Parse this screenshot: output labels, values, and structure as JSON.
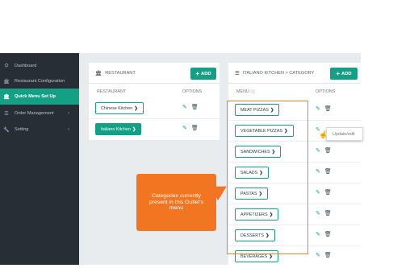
{
  "sidebar": {
    "items": [
      {
        "label": "Dashboard",
        "icon": "dashboard-icon",
        "glyph": "⛭",
        "active": false,
        "has_chevron": false
      },
      {
        "label": "Restaurant Configuration",
        "icon": "bank-icon",
        "glyph": "🏛",
        "active": false,
        "has_chevron": false
      },
      {
        "label": "Quick Menu Set Up",
        "icon": "bank-icon",
        "glyph": "🏛",
        "active": true,
        "has_chevron": false
      },
      {
        "label": "Order Management",
        "icon": "list-icon",
        "glyph": "☰",
        "active": false,
        "has_chevron": true
      },
      {
        "label": "Setting",
        "icon": "wrench-icon",
        "glyph": "🔧",
        "active": false,
        "has_chevron": true
      }
    ]
  },
  "restaurant_panel": {
    "title": "RESTAURANT",
    "add_label": "ADD",
    "col_restaurant": "RESTAURANT",
    "col_options": "OPTIONS",
    "rows": [
      {
        "name": "Chinese Kitchen",
        "selected": false
      },
      {
        "name": "Italiano Kitchen",
        "selected": true
      }
    ]
  },
  "category_panel": {
    "title": "ITALIANO KITCHEN > CATEGORY",
    "add_label": "ADD",
    "col_menu": "MENU",
    "col_options": "OPTIONS",
    "rows": [
      {
        "name": "MEAT PIZZAS"
      },
      {
        "name": "VEGETABLE PIZZAS"
      },
      {
        "name": "SANDWICHES"
      },
      {
        "name": "SALADS"
      },
      {
        "name": "PASTAS"
      },
      {
        "name": "APPETIZERS"
      },
      {
        "name": "DESSERTS"
      },
      {
        "name": "BEVERAGES"
      }
    ]
  },
  "tooltip": {
    "text": "Update/edit"
  },
  "callout": {
    "text": "Categories currently present in this Outlet's menu"
  },
  "colors": {
    "accent": "#14a085",
    "sidebar_bg": "#272e36",
    "callout": "#f27522"
  }
}
